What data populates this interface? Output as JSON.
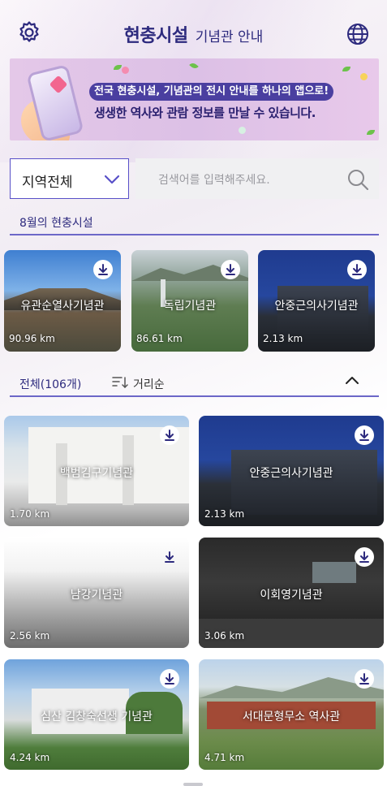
{
  "header": {
    "title_main": "현충시설",
    "title_sub": "기념관 안내",
    "settings_icon": "gear-icon",
    "language_icon": "globe-icon"
  },
  "banner": {
    "line1": "전국 현충시설, 기념관의 전시 안내를 하나의 앱으로!",
    "line2": "생생한 역사와 관람 정보를 만날 수 있습니다."
  },
  "filter": {
    "region_selected": "지역전체",
    "search_placeholder": "검색어를 입력해주세요."
  },
  "monthly": {
    "title": "8월의 현충시설",
    "cards": [
      {
        "name": "유관순열사기념관",
        "distance": "90.96 km"
      },
      {
        "name": "독립기념관",
        "distance": "86.61 km"
      },
      {
        "name": "안중근의사기념관",
        "distance": "2.13 km"
      }
    ]
  },
  "all": {
    "title": "전체(106개)",
    "sort_label": "거리순",
    "cards": [
      {
        "name": "백범김구기념관",
        "distance": "1.70 km"
      },
      {
        "name": "안중근의사기념관",
        "distance": "2.13 km"
      },
      {
        "name": "남강기념관",
        "distance": "2.56 km"
      },
      {
        "name": "이회영기념관",
        "distance": "3.06 km"
      },
      {
        "name": "심산 김창숙선생 기념관",
        "distance": "4.24 km"
      },
      {
        "name": "서대문형무소 역사관",
        "distance": "4.71 km"
      }
    ]
  },
  "colors": {
    "brand": "#2d2a7e",
    "accent": "#5850c8",
    "banner_bg": "#dcc0e6"
  }
}
